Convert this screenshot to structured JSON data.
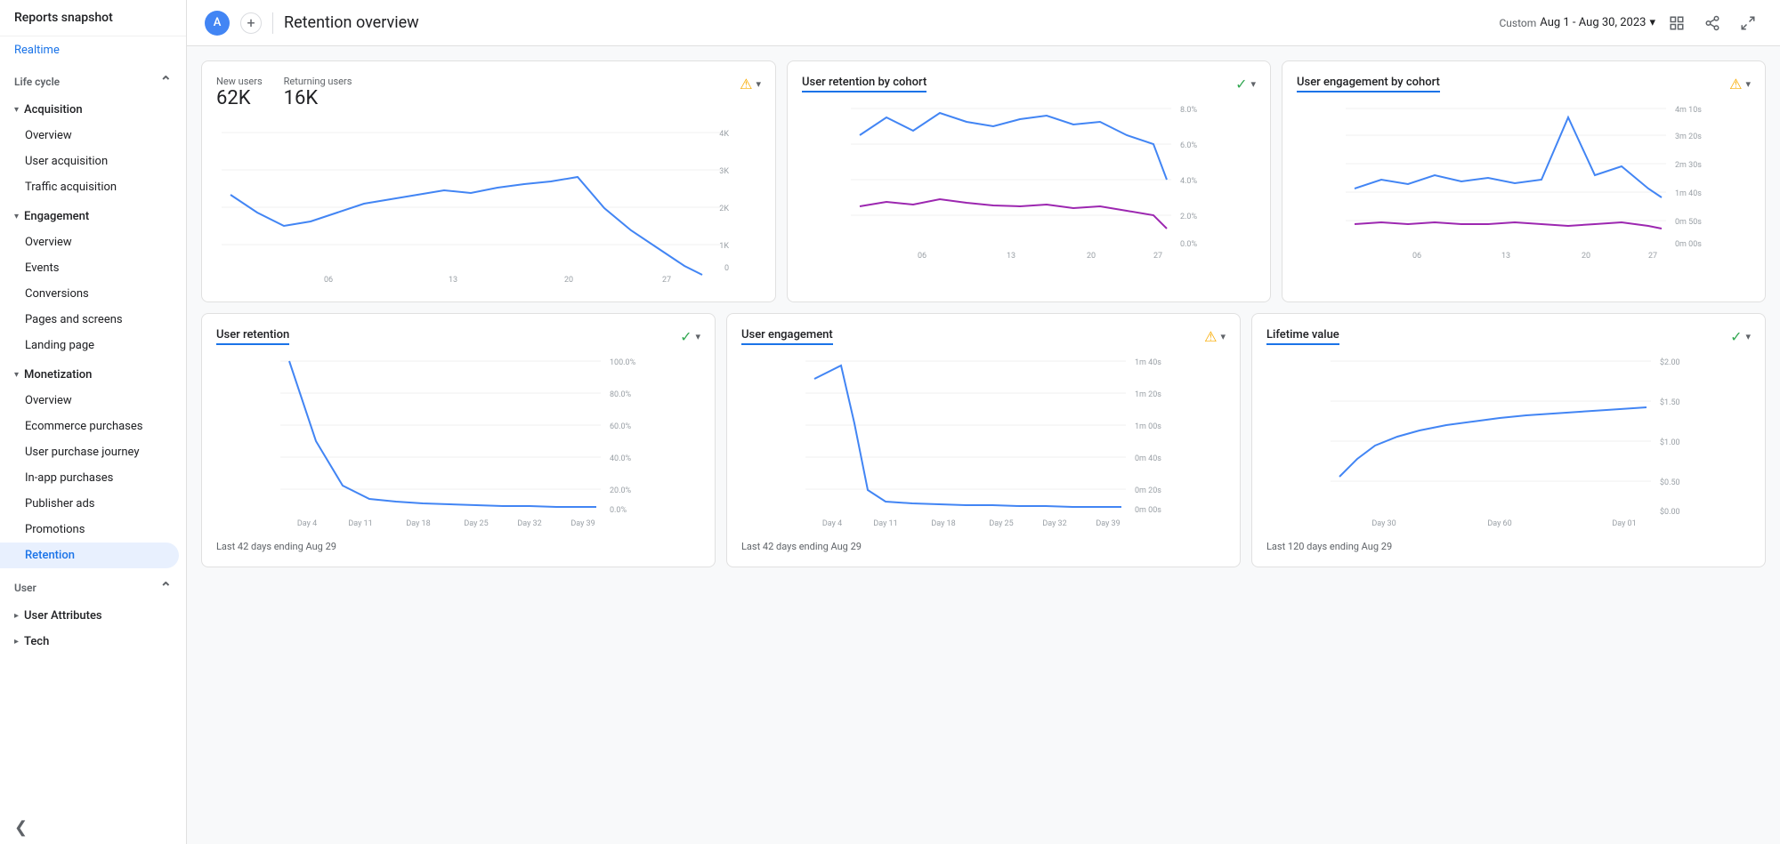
{
  "sidebar": {
    "header": "Reports snapshot",
    "realtime": "Realtime",
    "lifecycle_label": "Life cycle",
    "acquisition_label": "Acquisition",
    "acquisition_items": [
      "Overview",
      "User acquisition",
      "Traffic acquisition"
    ],
    "engagement_label": "Engagement",
    "engagement_items": [
      "Overview",
      "Events",
      "Conversions",
      "Pages and screens",
      "Landing page"
    ],
    "monetization_label": "Monetization",
    "monetization_items": [
      "Overview",
      "Ecommerce purchases",
      "User purchase journey",
      "In-app purchases",
      "Publisher ads",
      "Promotions"
    ],
    "retention_label": "Retention",
    "user_label": "User",
    "user_items": [
      "User Attributes"
    ],
    "tech_label": "Tech"
  },
  "topbar": {
    "avatar": "A",
    "title": "Retention overview",
    "date_label": "Custom",
    "date_value": "Aug 1 - Aug 30, 2023"
  },
  "chart1": {
    "title": "New users",
    "stat1_label": "New users",
    "stat1_value": "62K",
    "stat2_label": "Returning users",
    "stat2_value": "16K",
    "badge": "warn",
    "y_labels": [
      "4K",
      "3K",
      "2K",
      "1K",
      "0"
    ],
    "x_labels": [
      "06\nAug",
      "13",
      "20",
      "27"
    ]
  },
  "chart2": {
    "title": "User retention by cohort",
    "badge": "ok",
    "y_labels": [
      "8.0%",
      "6.0%",
      "4.0%",
      "2.0%",
      "0.0%"
    ],
    "x_labels": [
      "06\nAug",
      "13",
      "20",
      "27"
    ]
  },
  "chart3": {
    "title": "User engagement by cohort",
    "badge": "warn",
    "y_labels": [
      "4m 10s",
      "3m 20s",
      "2m 30s",
      "1m 40s",
      "0m 50s",
      "0m 00s"
    ],
    "x_labels": [
      "06\nAug",
      "13",
      "20",
      "27"
    ]
  },
  "chart4": {
    "title": "User retention",
    "badge": "ok",
    "y_labels": [
      "100.0%",
      "80.0%",
      "60.0%",
      "40.0%",
      "20.0%",
      "0.0%"
    ],
    "x_labels": [
      "Day 4",
      "Day 11",
      "Day 18",
      "Day 25",
      "Day 32",
      "Day 39"
    ],
    "footer": "Last 42 days ending Aug 29"
  },
  "chart5": {
    "title": "User engagement",
    "badge": "warn",
    "y_labels": [
      "1m 40s",
      "1m 20s",
      "1m 00s",
      "0m 40s",
      "0m 20s",
      "0m 00s"
    ],
    "x_labels": [
      "Day 4",
      "Day 11",
      "Day 18",
      "Day 25",
      "Day 32",
      "Day 39"
    ],
    "footer": "Last 42 days ending Aug 29"
  },
  "chart6": {
    "title": "Lifetime value",
    "badge": "ok",
    "y_labels": [
      "$2.00",
      "$1.50",
      "$1.00",
      "$0.50",
      "$0.00"
    ],
    "x_labels": [
      "Day 30",
      "Day 60",
      "Day 01"
    ],
    "footer": "Last 120 days ending Aug 29"
  }
}
